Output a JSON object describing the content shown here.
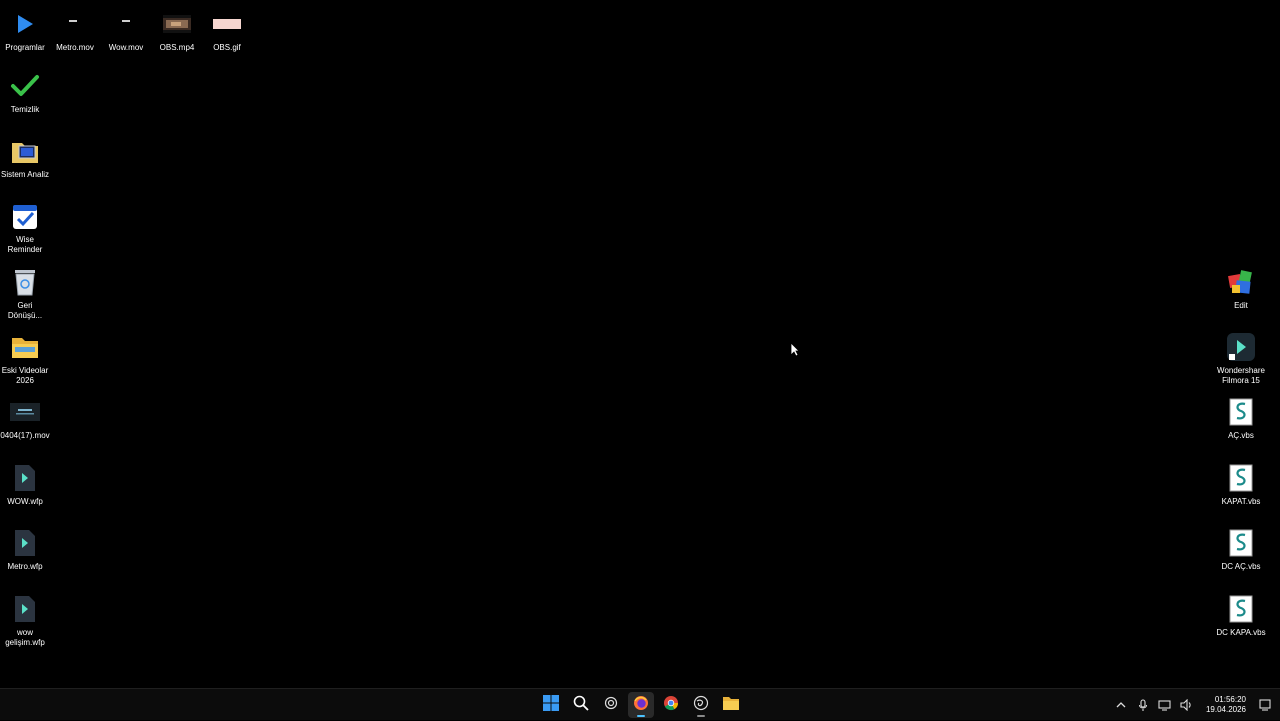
{
  "desktop": {
    "top_row": [
      {
        "label": "Programlar",
        "icon": "play-icon"
      },
      {
        "label": "Metro.mov",
        "icon": "video-file-icon"
      },
      {
        "label": "Wow.mov",
        "icon": "video-file-icon"
      },
      {
        "label": "OBS.mp4",
        "icon": "video-thumbnail-icon"
      },
      {
        "label": "OBS.gif",
        "icon": "gif-thumbnail-icon"
      }
    ],
    "left_column": [
      {
        "label": "Temizlik",
        "icon": "checkmark-icon"
      },
      {
        "label": "Sistem Analiz",
        "icon": "system-folder-icon"
      },
      {
        "label": "Wise Reminder",
        "icon": "reminder-icon"
      },
      {
        "label": "Geri Dönüşü...",
        "icon": "recycle-bin-icon"
      },
      {
        "label": "Eski Videolar 2026",
        "icon": "folder-icon"
      },
      {
        "label": "0404(17).mov",
        "icon": "video-thumbnail-icon"
      },
      {
        "label": "WOW.wfp",
        "icon": "filmora-project-icon"
      },
      {
        "label": "Metro.wfp",
        "icon": "filmora-project-icon"
      },
      {
        "label": "wow gelişim.wfp",
        "icon": "filmora-project-icon"
      }
    ],
    "right_column": [
      {
        "label": "Edit",
        "icon": "edit-app-icon"
      },
      {
        "label": "Wondershare Filmora 15",
        "icon": "filmora-app-icon"
      },
      {
        "label": "AÇ.vbs",
        "icon": "script-icon"
      },
      {
        "label": "KAPAT.vbs",
        "icon": "script-icon"
      },
      {
        "label": "DC AÇ.vbs",
        "icon": "script-icon"
      },
      {
        "label": "DC KAPA.vbs",
        "icon": "script-icon"
      }
    ]
  },
  "taskbar": {
    "apps": [
      {
        "name": "start-button",
        "icon": "windows-icon"
      },
      {
        "name": "search-button",
        "icon": "search-icon"
      },
      {
        "name": "app-button",
        "icon": "circle-app-icon"
      },
      {
        "name": "firefox-button",
        "icon": "firefox-icon",
        "active": true
      },
      {
        "name": "chrome-button",
        "icon": "chrome-icon"
      },
      {
        "name": "app-button-2",
        "icon": "swirl-icon"
      },
      {
        "name": "file-explorer-button",
        "icon": "folder-icon"
      }
    ],
    "time": "01:56:20",
    "date": "19.04.2026"
  },
  "colors": {
    "background": "#000000",
    "accent": "#4cc2ff",
    "check_green": "#3ac24a",
    "windows_blue": "#3a9bf4"
  }
}
